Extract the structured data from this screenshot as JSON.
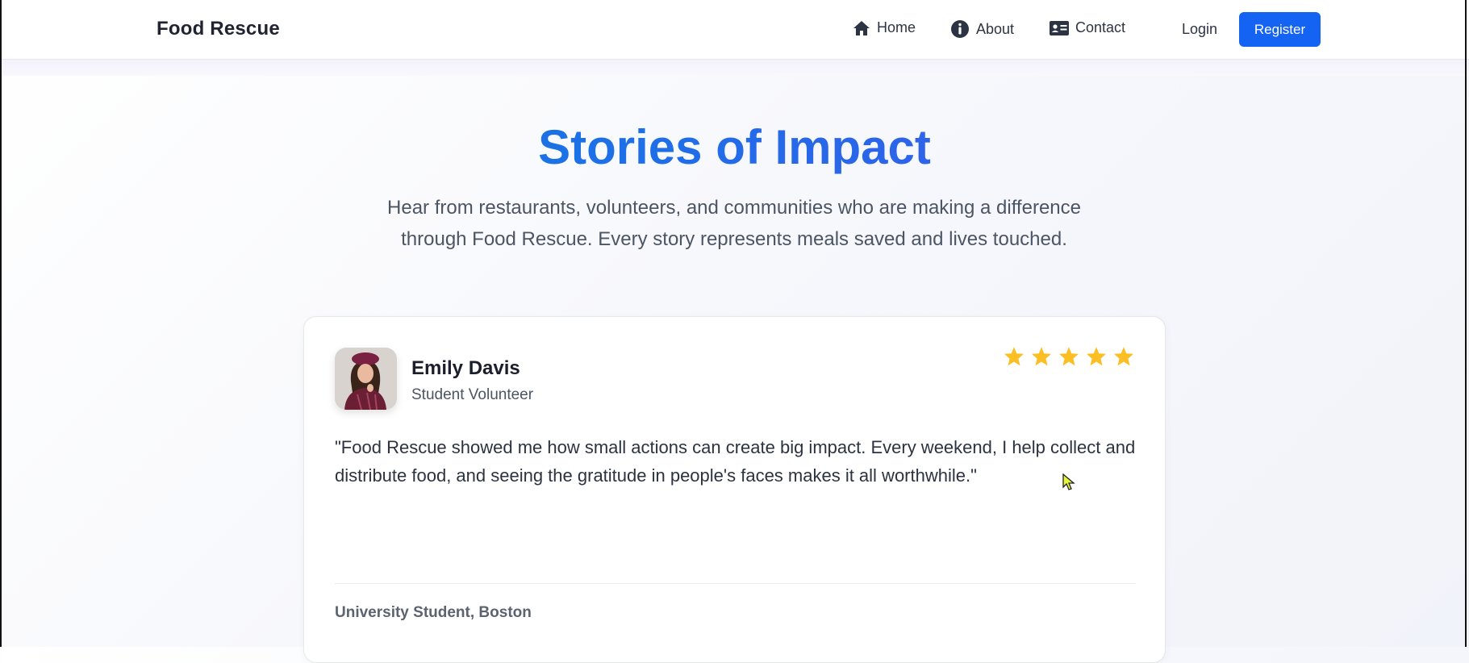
{
  "brand": "Food Rescue",
  "nav": {
    "home": "Home",
    "about": "About",
    "contact": "Contact",
    "login": "Login",
    "register": "Register"
  },
  "hero": {
    "title": "Stories of Impact",
    "subtitle_line1": "Hear from restaurants, volunteers, and communities who are making a difference",
    "subtitle_line2": "through Food Rescue. Every story represents meals saved and lives touched."
  },
  "testimonial": {
    "name": "Emily Davis",
    "role": "Student Volunteer",
    "rating": 5,
    "rating_max": 5,
    "quote": "\"Food Rescue showed me how small actions can create big impact. Every weekend, I help collect and distribute food, and seeing the gratitude in people's faces makes it all worthwhile.\"",
    "location": "University Student, Boston"
  },
  "colors": {
    "accent": "#1463f3",
    "title_gradient_start": "#0b86d6",
    "title_gradient_end": "#4d4fe6",
    "star": "#fbbf24"
  },
  "icons": {
    "home": "home-icon",
    "about": "info-circle-icon",
    "contact": "id-card-icon",
    "rating": "star-icon"
  }
}
